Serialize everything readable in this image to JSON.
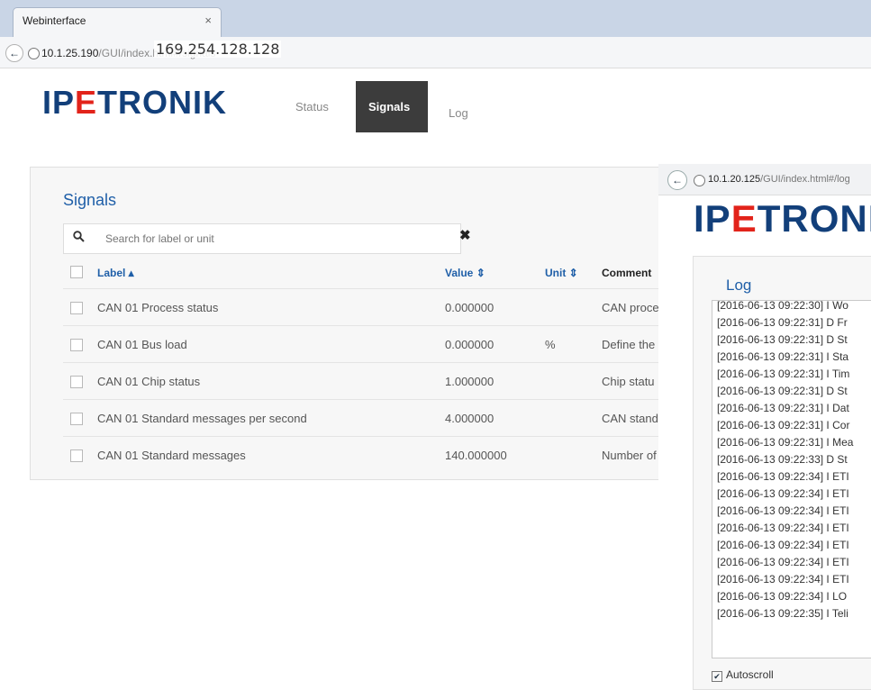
{
  "window1": {
    "tab_title": "Webinterface",
    "tab_close": "×",
    "back_glyph": "←",
    "url_host": "10.1.25.190",
    "url_path": "/GUI/index.html#/signals",
    "overlay_ip": "169.254.128.128",
    "logo_pre": "IP",
    "logo_e": "E",
    "logo_post": "TRONIK",
    "nav": {
      "status": "Status",
      "signals": "Signals",
      "log": "Log"
    },
    "panel_title": "Signals",
    "search_placeholder": "Search for label or unit",
    "search_icon_glyph": "🔍",
    "clear_glyph": "✖",
    "columns": {
      "label": "Label ▴",
      "value": "Value ⇕",
      "unit": "Unit ⇕",
      "comment": "Comment"
    },
    "rows": [
      {
        "label": "CAN 01 Process status",
        "value": "0.000000",
        "unit": "",
        "comment": "CAN proce"
      },
      {
        "label": "CAN 01 Bus load",
        "value": "0.000000",
        "unit": "%",
        "comment": "Define the"
      },
      {
        "label": "CAN 01 Chip status",
        "value": "1.000000",
        "unit": "",
        "comment": "Chip statu"
      },
      {
        "label": "CAN 01 Standard messages per second",
        "value": "4.000000",
        "unit": "",
        "comment": "CAN stand"
      },
      {
        "label": "CAN 01 Standard messages",
        "value": "140.000000",
        "unit": "",
        "comment": "Number of"
      }
    ]
  },
  "window2": {
    "back_glyph": "←",
    "url_host": "10.1.20.125",
    "url_path": "/GUI/index.html#/log",
    "logo_pre": "IP",
    "logo_e": "E",
    "logo_post": "TRONI",
    "panel_title": "Log",
    "log_lines": [
      "[2016-06-13 09:22:30]  I Wo",
      "[2016-06-13 09:22:31]  D Fr",
      "[2016-06-13 09:22:31]  D St",
      "[2016-06-13 09:22:31]  I Sta",
      "[2016-06-13 09:22:31]  I Tim",
      "[2016-06-13 09:22:31]  D St",
      "[2016-06-13 09:22:31]  I Dat",
      "[2016-06-13 09:22:31]  I Cor",
      "[2016-06-13 09:22:31]  I Mea",
      "[2016-06-13 09:22:33]  D St",
      "[2016-06-13 09:22:34]  I ETI",
      "[2016-06-13 09:22:34]  I ETI",
      "[2016-06-13 09:22:34]  I ETI",
      "[2016-06-13 09:22:34]  I ETI",
      "[2016-06-13 09:22:34]  I ETI",
      "[2016-06-13 09:22:34]  I ETI",
      "[2016-06-13 09:22:34]  I ETI",
      "[2016-06-13 09:22:34]  I LO",
      "[2016-06-13 09:22:35]  I Teli"
    ],
    "autoscroll_label": "Autoscroll",
    "autoscroll_checked": true,
    "check_glyph": "✔"
  },
  "colors": {
    "brand_blue": "#123f7a",
    "brand_red": "#e2231a",
    "link_blue": "#1f5fa8",
    "nav_active": "#3c3c3c"
  }
}
